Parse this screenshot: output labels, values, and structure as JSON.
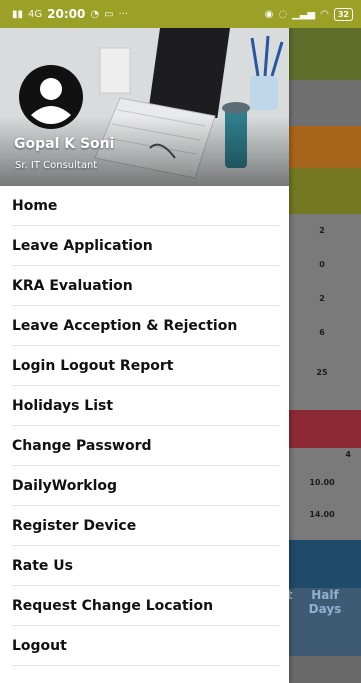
{
  "status_bar": {
    "signal_text": "4G",
    "time": "20:00",
    "more": "···",
    "battery": "32"
  },
  "colors": {
    "status_bar": "#9aa126",
    "text_dark": "#111111",
    "divider": "#e4e4e4"
  },
  "drawer": {
    "user_name": "Gopal K Soni",
    "user_role": "Sr. IT Consultant",
    "avatar_icon": "account-circle-icon",
    "menu": [
      {
        "label": "Home"
      },
      {
        "label": "Leave Application"
      },
      {
        "label": "KRA Evaluation"
      },
      {
        "label": "Leave Acception & Rejection"
      },
      {
        "label": "Login Logout Report"
      },
      {
        "label": "Holidays List"
      },
      {
        "label": "Change Password"
      },
      {
        "label": "DailyWorklog"
      },
      {
        "label": "Register Device"
      },
      {
        "label": "Rate Us"
      },
      {
        "label": "Request Change Location"
      },
      {
        "label": "Logout"
      }
    ]
  },
  "background": {
    "values": [
      "2",
      "0",
      "2",
      "6",
      "25",
      "4",
      "10.00",
      "14.00"
    ],
    "partial_label": "t",
    "half_days_line1": "Half",
    "half_days_line2": "Days"
  }
}
